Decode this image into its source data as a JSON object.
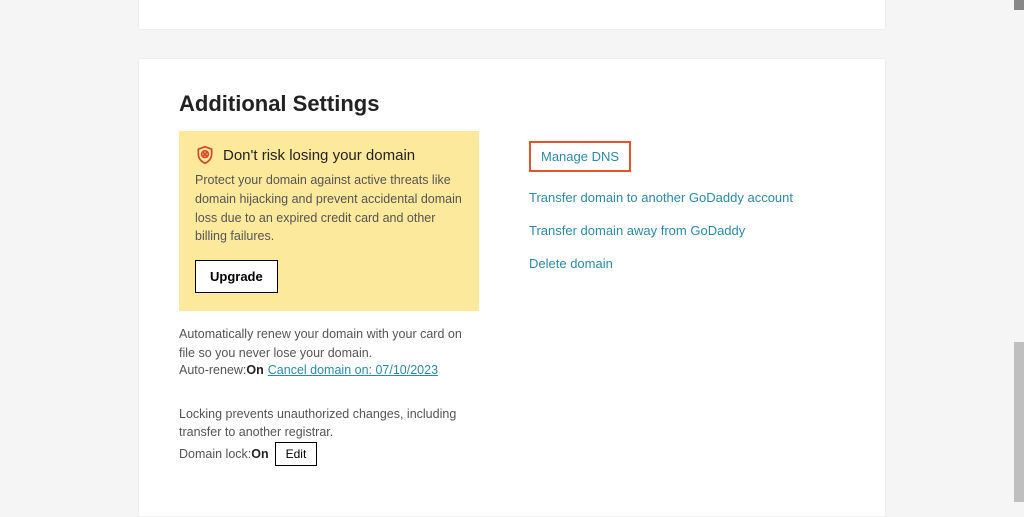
{
  "section": {
    "heading": "Additional Settings"
  },
  "callout": {
    "title": "Don't risk losing your domain",
    "body": "Protect your domain against active threats like domain hijacking and prevent accidental domain loss due to an expired credit card and other billing failures.",
    "upgrade_label": "Upgrade"
  },
  "autorenew": {
    "desc": "Automatically renew your domain with your card on file so you never lose your domain.",
    "label": "Auto-renew: ",
    "status": "On",
    "cancel_link": "Cancel domain on: 07/10/2023"
  },
  "lock": {
    "desc": "Locking prevents unauthorized changes, including transfer to another registrar.",
    "label": "Domain lock: ",
    "status": "On",
    "edit_label": "Edit"
  },
  "right_links": {
    "manage_dns": "Manage DNS",
    "transfer_another": "Transfer domain to another GoDaddy account",
    "transfer_away": "Transfer domain away from GoDaddy",
    "delete": "Delete domain"
  }
}
